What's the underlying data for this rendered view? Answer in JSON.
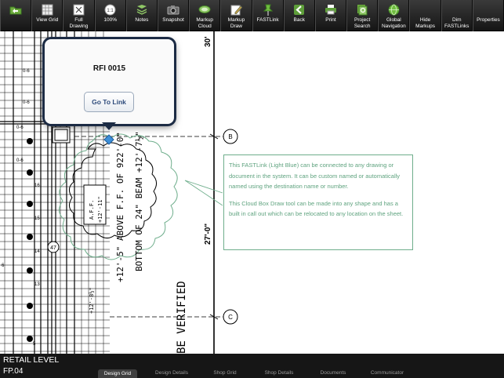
{
  "toolbar": {
    "items": [
      {
        "label": "",
        "icon": "folder-back-icon"
      },
      {
        "label": "View Grid",
        "icon": "grid-icon"
      },
      {
        "label": "Full\nDrawing",
        "icon": "full-drawing-icon"
      },
      {
        "label": "100%",
        "icon": "zoom-100-icon"
      },
      {
        "label": "Notes",
        "icon": "notes-icon"
      },
      {
        "label": "Snapshot",
        "icon": "camera-icon"
      },
      {
        "label": "Markup\nCloud",
        "icon": "cloud-icon"
      },
      {
        "label": "Markup\nDraw",
        "icon": "pencil-icon"
      },
      {
        "label": "FASTLink",
        "icon": "pushpin-icon"
      },
      {
        "label": "Back",
        "icon": "back-arrow-icon"
      },
      {
        "label": "Print",
        "icon": "printer-icon"
      },
      {
        "label": "Project\nSearch",
        "icon": "search-icon"
      },
      {
        "label": "Global\nNavigation",
        "icon": "globe-icon"
      },
      {
        "label": "Hide\nMarkups",
        "icon": "hide-markups-icon"
      },
      {
        "label": "Dim\nFASTLinks",
        "icon": "dim-links-icon"
      },
      {
        "label": "Properties",
        "icon": "properties-icon"
      }
    ]
  },
  "popover": {
    "title": "RFI 0015",
    "button_label": "Go To Link"
  },
  "callout": {
    "paragraph1": "This FASTLink (Light Blue) can be connected to any drawing or document in the system.  It can be custom named or automatically named using the destination name or number.",
    "paragraph2": "This Cloud Box Draw tool can be made into any shape and has a built in call out which can be relocated to any location on the sheet."
  },
  "drawing": {
    "grid_b": "B",
    "grid_c": "C",
    "dim_30": "30'",
    "dim_27": "27'-0\"",
    "note_line1": "+12'-5\" ABOVE F.F. OF 922'-0\"",
    "note_line2": "BOTTOM OF 24\" BEAM +12'-7½\"",
    "aff_label": "A.F.F.",
    "aff_value": "+12'-11\"",
    "verified_text": "BE VERIFIED",
    "verified_d": "D",
    "tag_47": "47",
    "tag_8": "+12'-8½\"",
    "tag_16": "16",
    "tag_15": "15",
    "tag_14": "14",
    "tag_13": "13",
    "tag_5": "5",
    "tag_6": "6",
    "tag_0a": "0-6",
    "tag_0b": "0-6",
    "tag_0c": "0-6",
    "tag_0d": "0-6"
  },
  "footer": {
    "level": "RETAIL LEVEL",
    "sheet": "FP.04",
    "tabs": [
      "Design Grid",
      "Design Details",
      "Shop Grid",
      "Shop Details",
      "Documents",
      "Communicator"
    ],
    "active_tab": "Design Grid"
  },
  "colors": {
    "toolbar_bg": "#222222",
    "icon_green": "#5e9e3a",
    "callout_green": "#5fa37f",
    "fastlink_blue": "#3d8fd8"
  }
}
